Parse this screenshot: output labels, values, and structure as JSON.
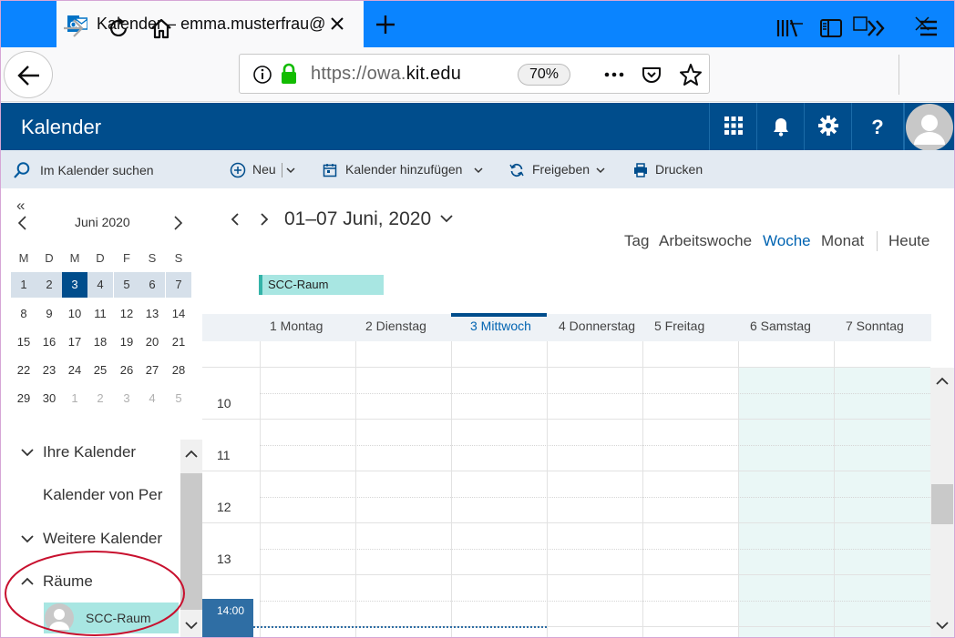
{
  "browser": {
    "tab_title": "Kalender – emma.musterfrau@k",
    "url_prefix": "https://owa.",
    "url_domain": "kit.edu",
    "zoom": "70%"
  },
  "header": {
    "app_title": "Kalender"
  },
  "left": {
    "search_placeholder": "Im Kalender suchen",
    "mini_calendar": {
      "double_prev": "«",
      "month": "Juni 2020",
      "weekdays": [
        "M",
        "D",
        "M",
        "D",
        "F",
        "S",
        "S"
      ],
      "weeks": [
        [
          "1",
          "2",
          "3",
          "4",
          "5",
          "6",
          "7"
        ],
        [
          "8",
          "9",
          "10",
          "11",
          "12",
          "13",
          "14"
        ],
        [
          "15",
          "16",
          "17",
          "18",
          "19",
          "20",
          "21"
        ],
        [
          "22",
          "23",
          "24",
          "25",
          "26",
          "27",
          "28"
        ],
        [
          "29",
          "30",
          "1",
          "2",
          "3",
          "4",
          "5"
        ]
      ],
      "today": "3"
    },
    "calendars": {
      "your_calendars": "Ihre Kalender",
      "calendar_of_person": "Kalender von Per",
      "other_calendars": "Weitere Kalender",
      "rooms": "Räume",
      "room_item": "SCC-Raum"
    }
  },
  "commands": {
    "new": "Neu",
    "add_calendar": "Kalender hinzufügen",
    "share": "Freigeben",
    "print": "Drucken"
  },
  "calendar": {
    "date_range": "01–07 Juni, 2020",
    "views": {
      "day": "Tag",
      "work_week": "Arbeitswoche",
      "week": "Woche",
      "month": "Monat",
      "today": "Heute"
    },
    "all_day_event": "SCC-Raum",
    "days": [
      "1 Montag",
      "2 Dienstag",
      "3 Mittwoch",
      "4 Donnerstag",
      "5 Freitag",
      "6 Samstag",
      "7 Sonntag"
    ],
    "hours": [
      "10",
      "11",
      "12",
      "13"
    ],
    "current_time": "14:00"
  },
  "colors": {
    "tab_bar": "#0a84ff",
    "owa_header": "#004d8c",
    "room_color": "#a8e6e2",
    "weekend": "#eaf7f6",
    "annotation": "#c8102e"
  }
}
